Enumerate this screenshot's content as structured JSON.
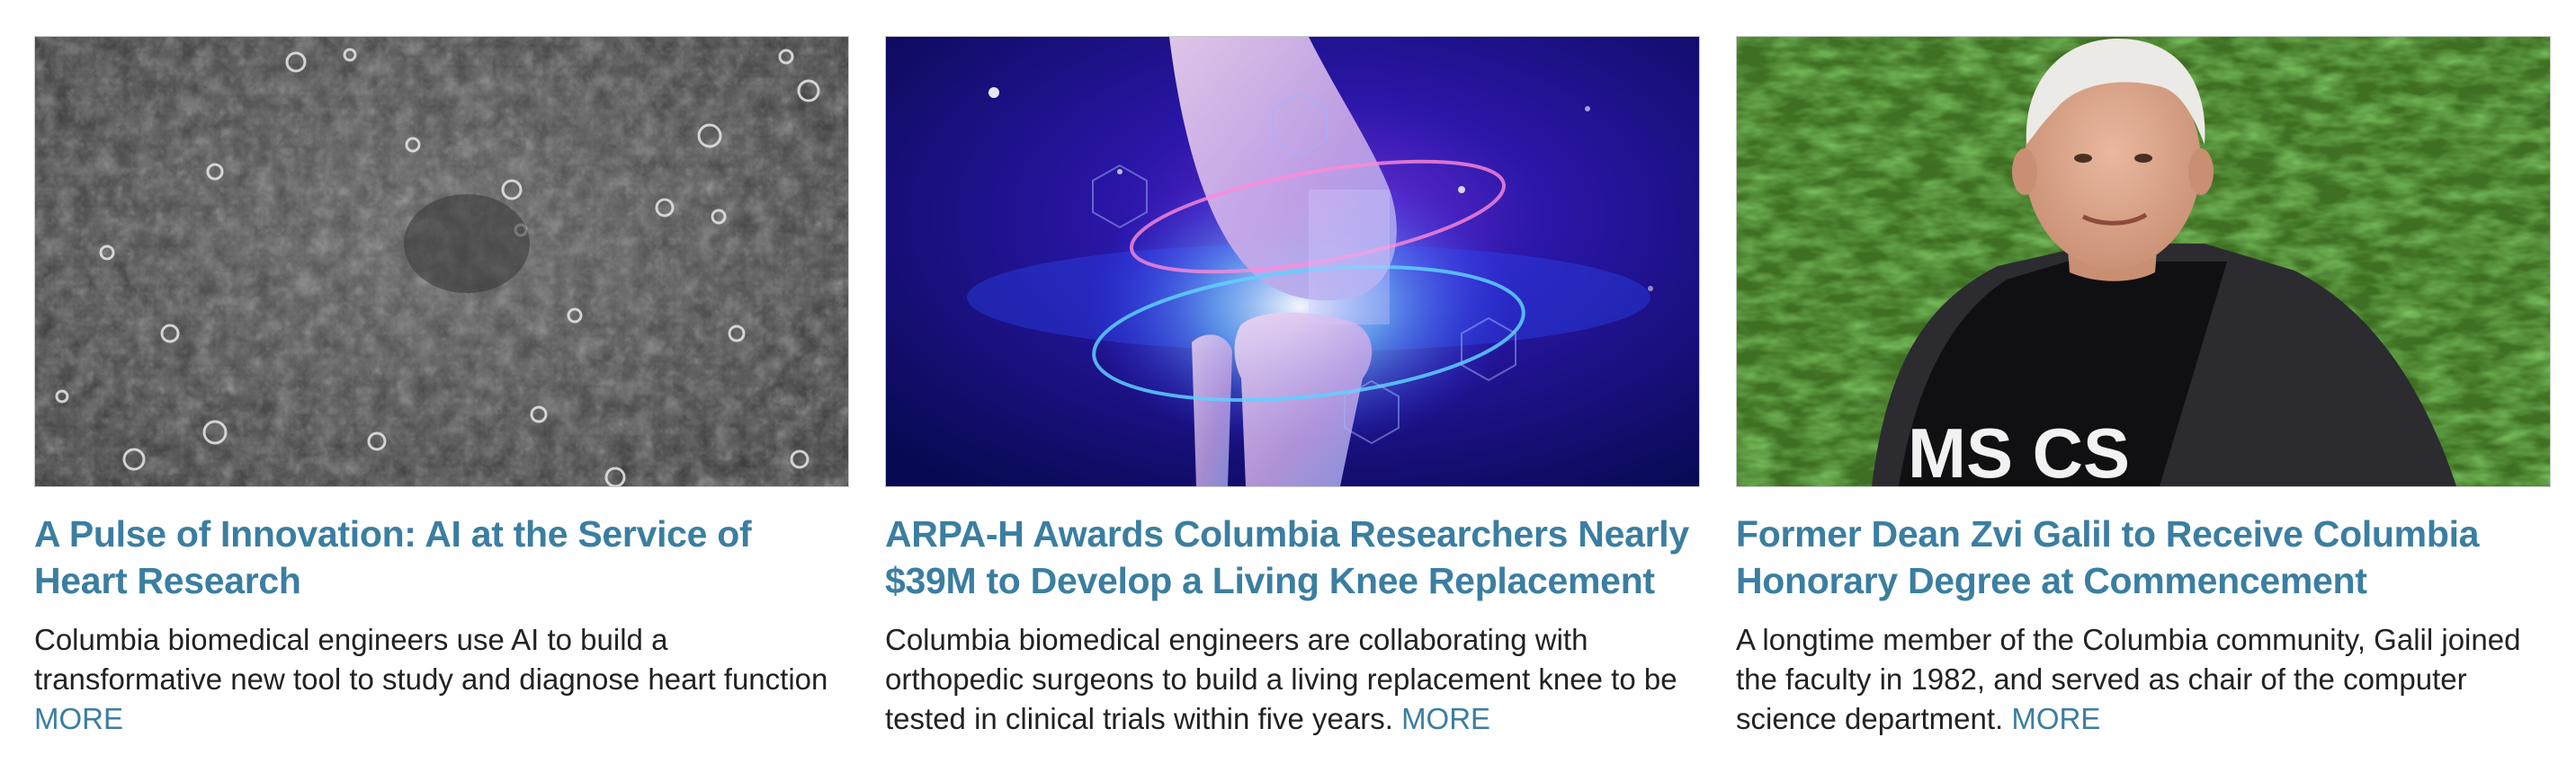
{
  "colors": {
    "accent": "#3b7ea1",
    "body_text": "#222222"
  },
  "cards": [
    {
      "image_alt": "Grayscale microscope image of heart cells",
      "title": "A Pulse of Innovation: AI at the Service of Heart Research",
      "body": "Columbia biomedical engineers use AI to build a transformative new tool to study and diagnose heart function",
      "more_label": "MORE"
    },
    {
      "image_alt": "Glowing illustration of a knee joint",
      "title": "ARPA-H Awards Columbia Researchers Nearly $39M to Develop a Living Knee Replacement",
      "body": "Columbia biomedical engineers are collaborating with orthopedic surgeons to build a living replacement knee to be tested in clinical trials within five years.",
      "more_label": "MORE"
    },
    {
      "image_alt": "Portrait of Zvi Galil in front of green foliage",
      "image_shirt_text": "MS CS",
      "title": "Former Dean Zvi Galil to Receive Columbia Honorary Degree at Commencement",
      "body": "A longtime member of the Columbia community, Galil joined the faculty in 1982, and served as chair of the computer science department.",
      "more_label": "MORE"
    }
  ]
}
